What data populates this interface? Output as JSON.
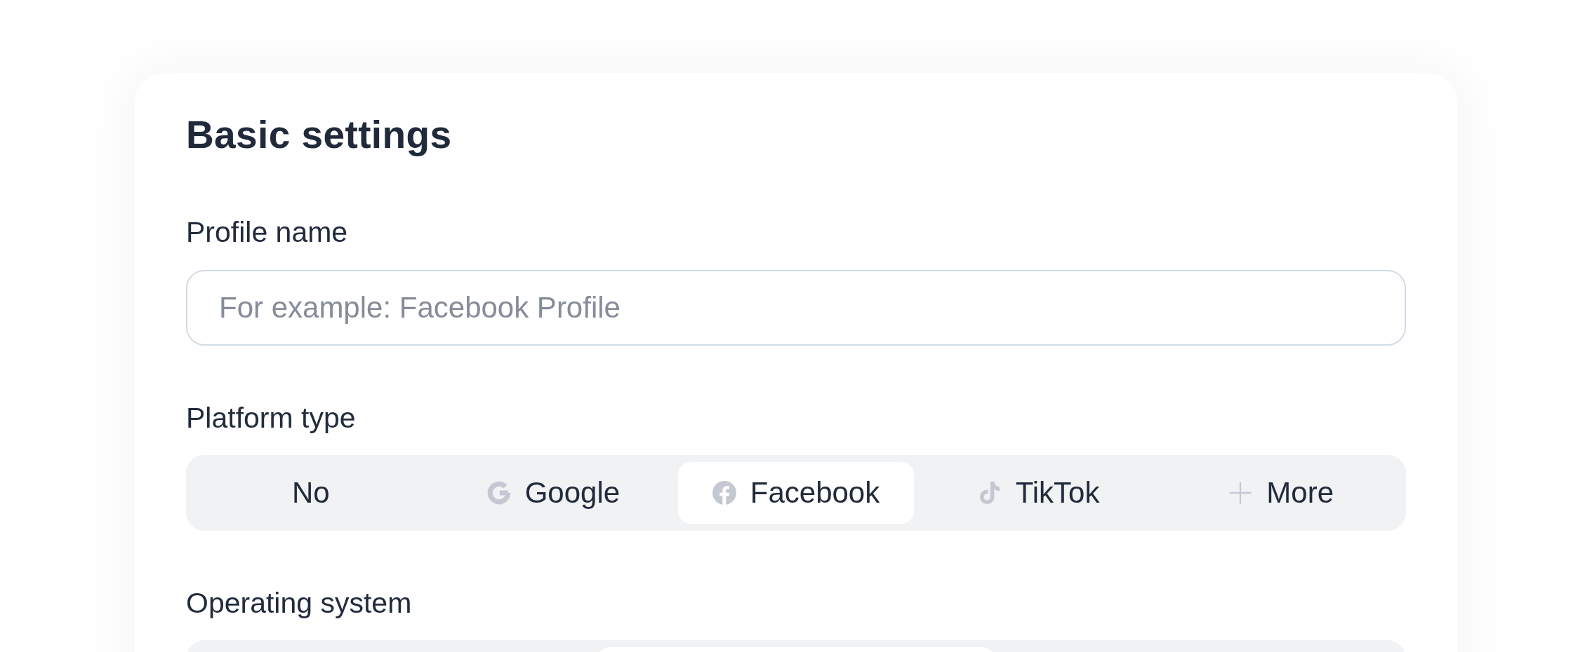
{
  "title": "Basic settings",
  "profile_name": {
    "label": "Profile name",
    "placeholder": "For example: Facebook Profile"
  },
  "platform_type": {
    "label": "Platform type",
    "options": [
      {
        "label": "No",
        "kind": "plain",
        "selected": false
      },
      {
        "label": "Google",
        "kind": "google",
        "selected": false
      },
      {
        "label": "Facebook",
        "kind": "facebook",
        "selected": true
      },
      {
        "label": "TikTok",
        "kind": "tiktok",
        "selected": false
      },
      {
        "label": "More",
        "kind": "add",
        "selected": false
      }
    ]
  },
  "operating_system": {
    "label": "Operating system",
    "options": [
      {
        "selected": false
      },
      {
        "selected": true
      },
      {
        "selected": false
      }
    ]
  }
}
